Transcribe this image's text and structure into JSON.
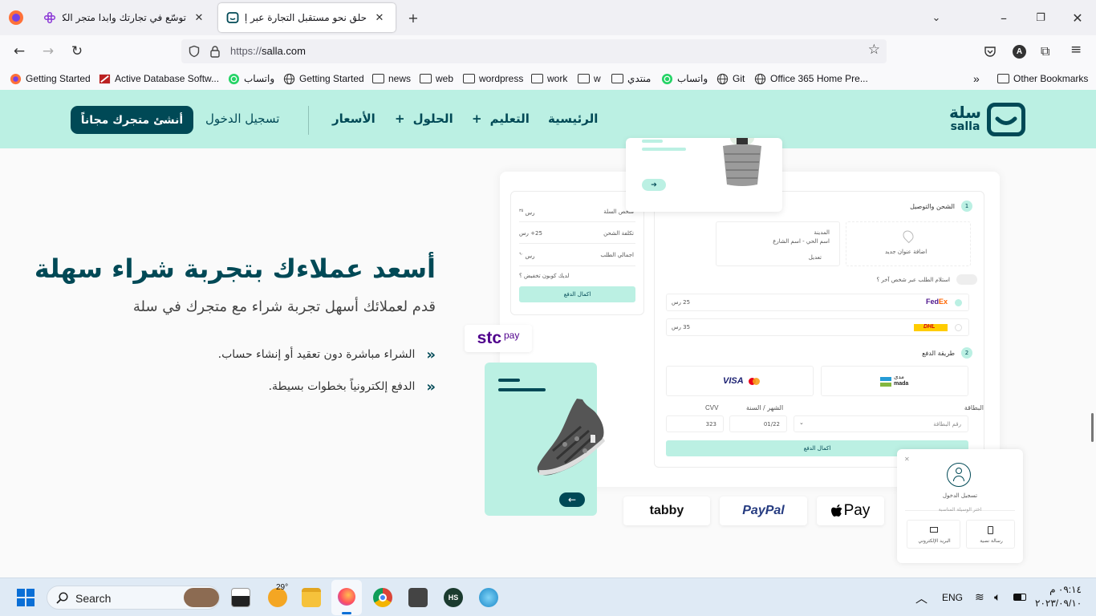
{
  "browser": {
    "tabs": [
      {
        "title": "توسّع في تجارتك وابدا متجر الكترو",
        "active": false
      },
      {
        "title": "حلق نحو مستقبل التجارة عبر إنشا",
        "active": true
      }
    ],
    "url_scheme": "https://",
    "url_host": "salla.com",
    "bookmarks": [
      {
        "label": "Getting Started",
        "icon": "firefox-icon"
      },
      {
        "label": "Active Database Softw...",
        "icon": "database-icon"
      },
      {
        "label": "واتساب",
        "icon": "whatsapp-icon"
      },
      {
        "label": "Getting Started",
        "icon": "globe-icon"
      },
      {
        "label": "news",
        "icon": "folder-icon"
      },
      {
        "label": "web",
        "icon": "folder-icon"
      },
      {
        "label": "wordpress",
        "icon": "folder-icon"
      },
      {
        "label": "work",
        "icon": "folder-icon"
      },
      {
        "label": "w",
        "icon": "folder-icon"
      },
      {
        "label": "منتدي",
        "icon": "folder-icon"
      },
      {
        "label": "واتساب",
        "icon": "whatsapp-icon"
      },
      {
        "label": "Git",
        "icon": "globe-icon"
      },
      {
        "label": "Office 365 Home Pre...",
        "icon": "globe-icon"
      }
    ],
    "other_bookmarks": "Other Bookmarks"
  },
  "site": {
    "logo_ar": "سلة",
    "logo_en": "salla",
    "nav": {
      "home": "الرئيسية",
      "learning": "التعليم",
      "solutions": "الحلول",
      "pricing": "الأسعار",
      "login": "تسجيل الدخول",
      "cta": "أنشئ متجرك مجاناً"
    },
    "hero": {
      "title": "أسعد عملاءك بتجربة شراء سهلة",
      "subtitle": "قدم لعملائك أسهل تجربة شراء مع متجرك في سلة",
      "bullets": [
        "الشراء مباشرة دون تعقيد أو إنشاء حساب.",
        "الدفع إلكترونياً بخطوات بسيطة."
      ]
    },
    "mock": {
      "summary": {
        "rows": [
          {
            "label": "ملخص السلة",
            "value": "رس",
            "sup": "٣٥"
          },
          {
            "label": "تكلفة الشحن",
            "value": "25+ رس",
            "sup": ""
          },
          {
            "label": "اجمالي الطلب",
            "value": "رس",
            "sup": "٦٠"
          }
        ],
        "coupon": "لديك كوبون تخفيض ؟",
        "pay_btn": "اكمال الدفع"
      },
      "shipping": {
        "step": "1",
        "title": "الشحن والتوصيل",
        "address_city": "المدينة",
        "address_line": "اسم الحي - اسم الشارع",
        "edit": "تعديل",
        "add_address": "اضافة عنوان جديد",
        "other_person": "استلام الطلب عبر شخص آخر ؟",
        "carriers": [
          {
            "name": "FedEx",
            "price": "25 رس"
          },
          {
            "name": "DHL",
            "price": "35 رس"
          }
        ]
      },
      "payment": {
        "step": "2",
        "title": "طريقة الدفع",
        "card_label": "البطاقة",
        "card_placeholder": "رقم البطاقة",
        "month_label": "الشهر / السنة",
        "month_value": "01/22",
        "cvv_label": "CVV",
        "cvv_value": "323",
        "pay_btn": "اكمال الدفع",
        "mada_ar": "مدى",
        "mada_en": "mada",
        "visa": "VISA"
      },
      "login_card": {
        "title": "تسجيل الدخول",
        "choose": "اختر الوسيلة المناسبة",
        "sms": "رسالة نصية",
        "email": "البريد الإلكتروني"
      },
      "stc_pay": {
        "stc": "stc",
        "pay": "pay"
      },
      "pay_logos": {
        "tabby": "tabby",
        "paypal": "PayPal",
        "apple_pay": "Pay"
      }
    }
  },
  "taskbar": {
    "search": "Search",
    "weather_temp": "29°",
    "lang": "ENG",
    "time": "٠٩:١٤ م",
    "date": "٢٠٢٣/٠٩/١٠"
  },
  "colors": {
    "brand_dark": "#004956",
    "brand_mint": "#bbf0e3"
  }
}
